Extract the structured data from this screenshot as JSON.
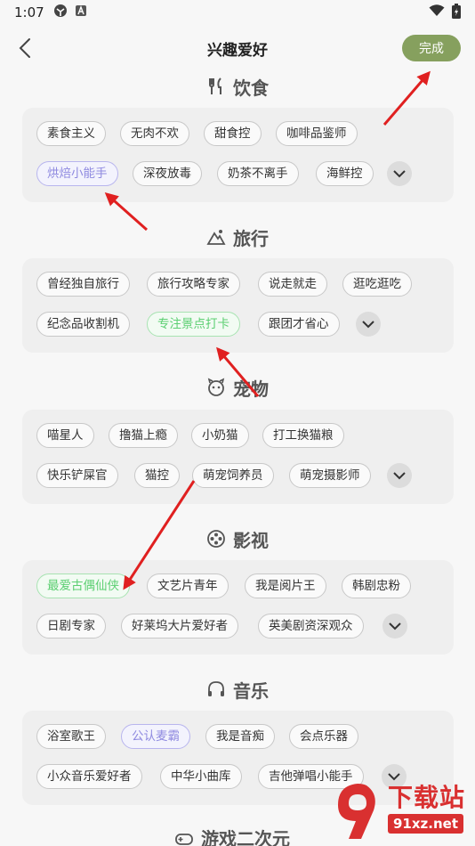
{
  "status": {
    "time": "1:07"
  },
  "header": {
    "title": "兴趣爱好",
    "done_label": "完成"
  },
  "sections": [
    {
      "title": "饮食",
      "icon": "utensils-icon",
      "tags": [
        "素食主义",
        "无肉不欢",
        "甜食控",
        "咖啡品鉴师",
        "烘焙小能手",
        "深夜放毒",
        "奶茶不离手",
        "海鲜控"
      ]
    },
    {
      "title": "旅行",
      "icon": "mountain-icon",
      "tags": [
        "曾经独自旅行",
        "旅行攻略专家",
        "说走就走",
        "逛吃逛吃",
        "纪念品收割机",
        "专注景点打卡",
        "跟团才省心"
      ]
    },
    {
      "title": "宠物",
      "icon": "pet-icon",
      "tags": [
        "喵星人",
        "撸猫上瘾",
        "小奶猫",
        "打工换猫粮",
        "快乐铲屎官",
        "猫控",
        "萌宠饲养员",
        "萌宠摄影师"
      ]
    },
    {
      "title": "影视",
      "icon": "film-reel-icon",
      "tags": [
        "最爱古偶仙侠",
        "文艺片青年",
        "我是阅片王",
        "韩剧忠粉",
        "日剧专家",
        "好莱坞大片爱好者",
        "英美剧资深观众"
      ]
    },
    {
      "title": "音乐",
      "icon": "headphones-icon",
      "tags": [
        "浴室歌王",
        "公认麦霸",
        "我是音痴",
        "会点乐器",
        "小众音乐爱好者",
        "中华小曲库",
        "吉他弹唱小能手"
      ]
    },
    {
      "title": "游戏二次元",
      "icon": "gamepad-icon",
      "tags": []
    }
  ],
  "colors": {
    "accent": "#86a05e",
    "selected_purple": "#8f8ae0",
    "selected_green": "#5ccf72",
    "annotation": "#e02020"
  },
  "watermark": {
    "text": "下载站",
    "url": "91xz.net"
  }
}
